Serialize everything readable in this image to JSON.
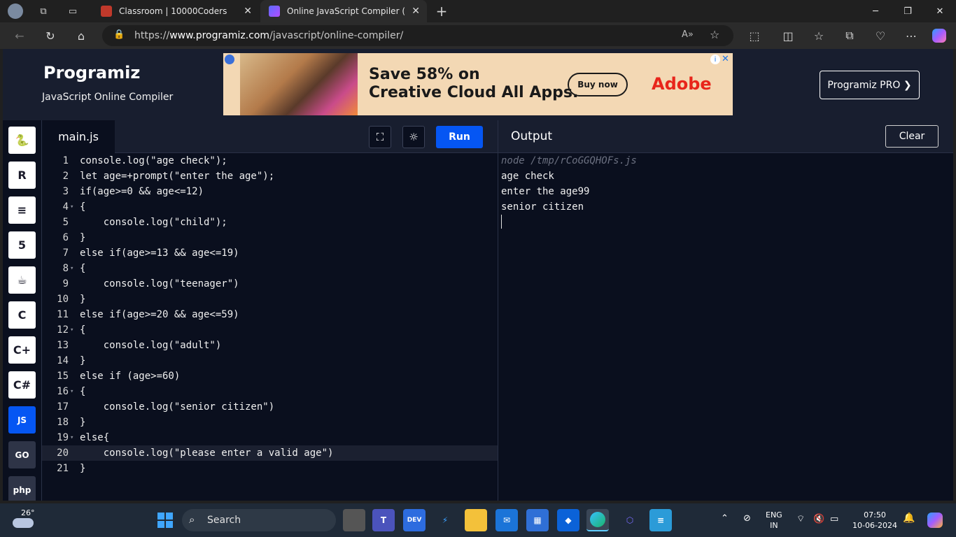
{
  "browser": {
    "tabs": [
      {
        "title": "Classroom | 10000Coders"
      },
      {
        "title": "Online JavaScript Compiler (Edito"
      }
    ],
    "url_prefix": "https://",
    "url_host": "www.programiz.com",
    "url_path": "/javascript/online-compiler/"
  },
  "header": {
    "logo": "Programiz",
    "subtitle": "JavaScript Online Compiler",
    "pro_button": "Programiz PRO ❯"
  },
  "ad": {
    "headline_1": "Save 58% on",
    "headline_2": "Creative Cloud All Apps.",
    "cta": "Buy now",
    "brand": "Adobe"
  },
  "sidebar": {
    "languages": [
      {
        "icon": "python-icon",
        "glyph": "🐍"
      },
      {
        "icon": "r-icon",
        "glyph": "R"
      },
      {
        "icon": "sql-icon",
        "glyph": "≡"
      },
      {
        "icon": "html-icon",
        "glyph": "5"
      },
      {
        "icon": "java-icon",
        "glyph": "☕"
      },
      {
        "icon": "c-icon",
        "glyph": "C"
      },
      {
        "icon": "cpp-icon",
        "glyph": "C+"
      },
      {
        "icon": "csharp-icon",
        "glyph": "C#"
      },
      {
        "icon": "js-icon",
        "glyph": "JS"
      },
      {
        "icon": "go-icon",
        "glyph": "GO"
      },
      {
        "icon": "php-icon",
        "glyph": "php"
      }
    ]
  },
  "editor": {
    "file_name": "main.js",
    "run_label": "Run",
    "lines": [
      "console.log(\"age check\");",
      "let age=+prompt(\"enter the age\");",
      "if(age>=0 && age<=12)",
      "{",
      "    console.log(\"child\");",
      "}",
      "else if(age>=13 && age<=19)",
      "{",
      "    console.log(\"teenager\")",
      "}",
      "else if(age>=20 && age<=59)",
      "{",
      "    console.log(\"adult\")",
      "}",
      "else if (age>=60)",
      "{",
      "    console.log(\"senior citizen\")",
      "}",
      "else{",
      "    console.log(\"please enter a valid age\")",
      "}"
    ]
  },
  "output": {
    "title": "Output",
    "clear_label": "Clear",
    "command": "node /tmp/rCoGGQHOFs.js",
    "lines": [
      "age check",
      "enter the age99",
      "senior citizen"
    ]
  },
  "taskbar": {
    "weather_temp": "26°",
    "search_label": "Search",
    "lang_1": "ENG",
    "lang_2": "IN",
    "time": "07:50",
    "date": "10-06-2024"
  }
}
